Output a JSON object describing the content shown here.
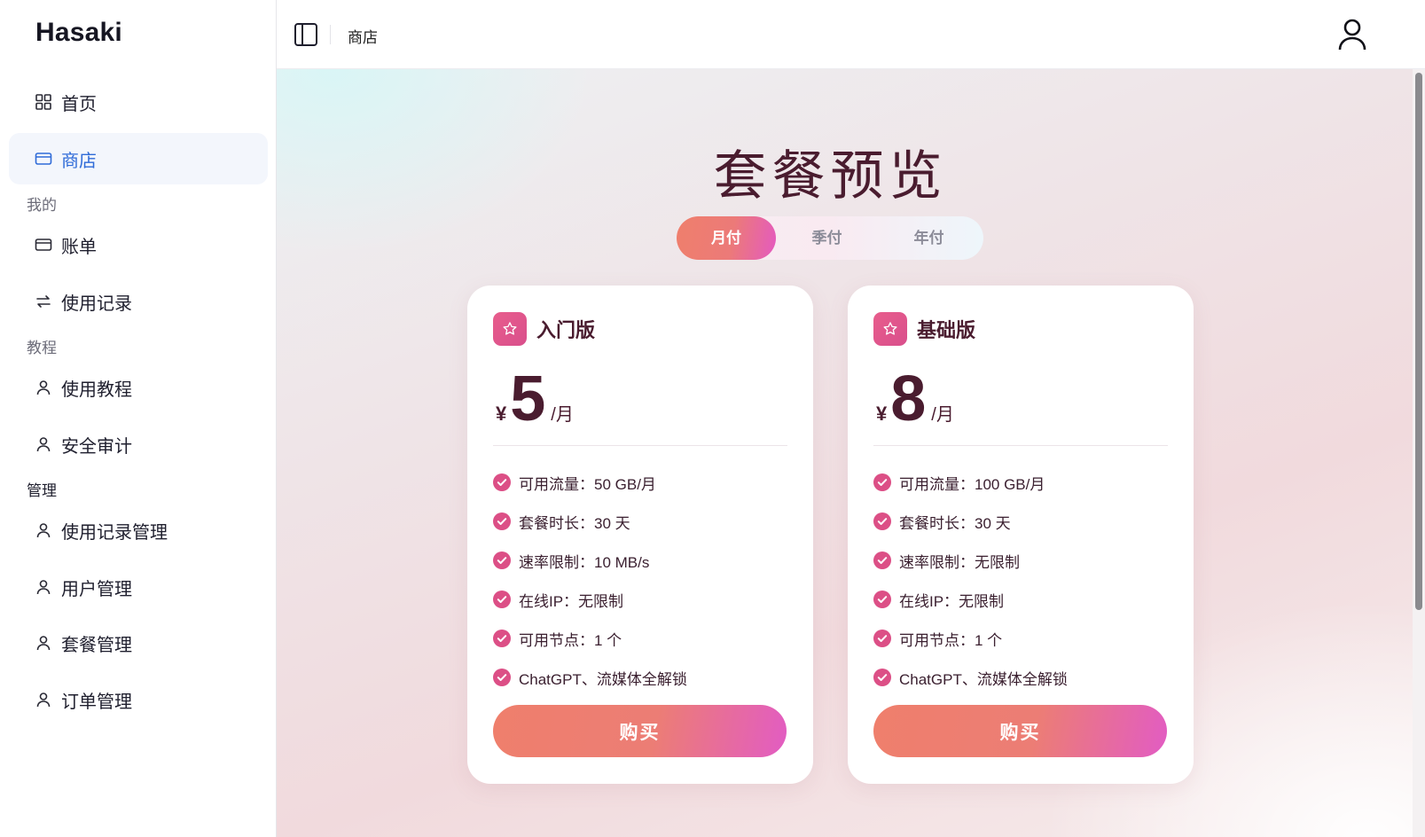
{
  "app": {
    "name": "Hasaki"
  },
  "sidebar": {
    "items": [
      {
        "label": "首页",
        "icon": "grid-icon"
      },
      {
        "label": "商店",
        "icon": "card-icon",
        "active": true
      }
    ],
    "sections": [
      {
        "label": "我的",
        "items": [
          {
            "label": "账单",
            "icon": "card-icon"
          },
          {
            "label": "使用记录",
            "icon": "swap-icon"
          }
        ]
      },
      {
        "label": "教程",
        "items": [
          {
            "label": "使用教程",
            "icon": "user-icon"
          },
          {
            "label": "安全审计",
            "icon": "user-icon"
          }
        ]
      },
      {
        "label": "管理",
        "items": [
          {
            "label": "使用记录管理",
            "icon": "user-icon"
          },
          {
            "label": "用户管理",
            "icon": "user-icon"
          },
          {
            "label": "套餐管理",
            "icon": "user-icon"
          },
          {
            "label": "订单管理",
            "icon": "user-icon"
          }
        ]
      }
    ]
  },
  "header": {
    "breadcrumb": "商店"
  },
  "main": {
    "title": "套餐预览",
    "periods": [
      {
        "label": "月付",
        "active": true
      },
      {
        "label": "季付",
        "active": false
      },
      {
        "label": "年付",
        "active": false
      }
    ],
    "plans": [
      {
        "name": "入门版",
        "currency": "¥",
        "price": "5",
        "unit": "/月",
        "features": [
          "可用流量：50 GB/月",
          "套餐时长：30 天",
          "速率限制：10 MB/s",
          "在线IP：无限制",
          "可用节点：1 个",
          "ChatGPT、流媒体全解锁"
        ],
        "button": "购买"
      },
      {
        "name": "基础版",
        "currency": "¥",
        "price": "8",
        "unit": "/月",
        "features": [
          "可用流量：100 GB/月",
          "套餐时长：30 天",
          "速率限制：无限制",
          "在线IP：无限制",
          "可用节点：1 个",
          "ChatGPT、流媒体全解锁"
        ],
        "button": "购买"
      }
    ]
  },
  "colors": {
    "accent": "#2f6bd8",
    "title": "#4a1c2f",
    "brand_pink": "#e0568a",
    "button_start": "#ef7f6c",
    "button_end": "#e25cc3"
  }
}
